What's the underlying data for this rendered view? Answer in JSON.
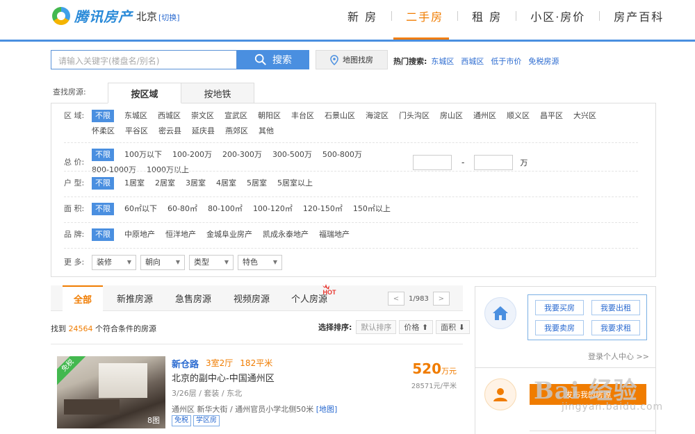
{
  "header": {
    "logo_text": "腾讯房产",
    "city": "北京",
    "city_switch": "[切换]",
    "nav": [
      "新 房",
      "二手房",
      "租 房",
      "小区·房价",
      "房产百科"
    ],
    "active_nav": "二手房"
  },
  "search": {
    "placeholder": "请输入关键字(楼盘名/别名)",
    "button": "搜索",
    "map_button": "地图找房",
    "hot_label": "热门搜索:",
    "hot_links": [
      "东城区",
      "西城区",
      "低于市价",
      "免税房源"
    ]
  },
  "filter": {
    "find_label": "查找房源:",
    "tabs": [
      "按区域",
      "按地铁"
    ],
    "rows": {
      "area": {
        "label": "区 域:",
        "options": [
          "不限",
          "东城区",
          "西城区",
          "崇文区",
          "宣武区",
          "朝阳区",
          "丰台区",
          "石景山区",
          "海淀区",
          "门头沟区",
          "房山区",
          "通州区",
          "顺义区",
          "昌平区",
          "大兴区",
          "怀柔区",
          "平谷区",
          "密云县",
          "延庆县",
          "燕郊区",
          "其他"
        ]
      },
      "price": {
        "label": "总 价:",
        "options": [
          "不限",
          "100万以下",
          "100-200万",
          "200-300万",
          "300-500万",
          "500-800万",
          "800-1000万",
          "1000万以上"
        ],
        "range_sep": "-",
        "unit": "万"
      },
      "layout": {
        "label": "户 型:",
        "options": [
          "不限",
          "1居室",
          "2居室",
          "3居室",
          "4居室",
          "5居室",
          "5居室以上"
        ]
      },
      "size": {
        "label": "面 积:",
        "options": [
          "不限",
          "60㎡以下",
          "60-80㎡",
          "80-100㎡",
          "100-120㎡",
          "120-150㎡",
          "150㎡以上"
        ]
      },
      "brand": {
        "label": "品 牌:",
        "options": [
          "不限",
          "中原地产",
          "恒洋地产",
          "金城阜业房产",
          "凯成永泰地产",
          "福瑞地产"
        ]
      },
      "more": {
        "label": "更 多:",
        "dropdowns": [
          "装修",
          "朝向",
          "类型",
          "特色"
        ]
      }
    }
  },
  "listing_tabs": {
    "tabs": [
      "全部",
      "新推房源",
      "急售房源",
      "视频房源",
      "个人房源"
    ],
    "hot_badge": "HOT",
    "page": "1/983",
    "prev": "<",
    "next": ">"
  },
  "results": {
    "found_prefix": "找到",
    "count": "24564",
    "found_suffix": "个符合条件的房源",
    "sort_label": "选择排序:",
    "sort_default": "默认排序",
    "sort_price": "价格 ⬆",
    "sort_area": "面积 ⬇"
  },
  "listing": {
    "badge": "免税",
    "photo_count": "8图",
    "name": "新仓路",
    "rooms": "3室2厅",
    "area": "182平米",
    "desc": "北京的副中心-中国通州区",
    "meta": "3/26层 / 套装 / 东北",
    "address": "通州区 新华大街 / 通州官员小学北侧50米",
    "map_link": "[地图]",
    "tags": [
      "免税",
      "学区房"
    ],
    "price": "520",
    "price_unit": "万元",
    "unit_price": "28571元/平米"
  },
  "side": {
    "buttons": [
      "我要买房",
      "我要出租",
      "我要卖房",
      "我要求租"
    ],
    "login": "登录个人中心 >>",
    "orange_text": "发布我的房源"
  },
  "watermark": {
    "main": "Bai 经验",
    "sub": "jingyan.baidu.com"
  }
}
